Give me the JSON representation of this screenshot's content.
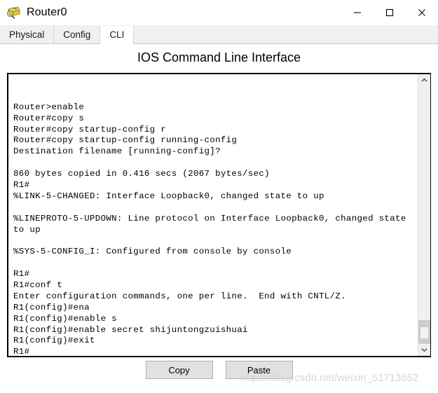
{
  "window": {
    "title": "Router0",
    "icon": "packet-tracer-router-icon",
    "controls": {
      "minimize": "—",
      "maximize": "□",
      "close": "✕"
    }
  },
  "tabs": [
    {
      "label": "Physical",
      "active": false
    },
    {
      "label": "Config",
      "active": false
    },
    {
      "label": "CLI",
      "active": true
    }
  ],
  "panel": {
    "title": "IOS Command Line Interface"
  },
  "terminal": {
    "lines": [
      "",
      "",
      "Router>enable",
      "Router#copy s",
      "Router#copy startup-config r",
      "Router#copy startup-config running-config",
      "Destination filename [running-config]?",
      "",
      "860 bytes copied in 0.416 secs (2067 bytes/sec)",
      "R1#",
      "%LINK-5-CHANGED: Interface Loopback0, changed state to up",
      "",
      "%LINEPROTO-5-UPDOWN: Line protocol on Interface Loopback0, changed state",
      "to up",
      "",
      "%SYS-5-CONFIG_I: Configured from console by console",
      "",
      "R1#",
      "R1#conf t",
      "Enter configuration commands, one per line.  End with CNTL/Z.",
      "R1(config)#ena",
      "R1(config)#enable s",
      "R1(config)#enable secret shijuntongzuishuai",
      "R1(config)#exit",
      "R1#"
    ]
  },
  "scrollbar": {
    "up_arrow": "ⱏ",
    "down_arrow": "ⱟ"
  },
  "buttons": {
    "copy": "Copy",
    "paste": "Paste"
  },
  "watermark": {
    "text": "https://blog.csdn.net/weixin_51713652"
  },
  "colors": {
    "tab_active_bg": "#ffffff",
    "tab_inactive_bg": "#f0f0f0",
    "button_bg": "#e1e1e1",
    "terminal_border": "#000000",
    "scrollbar_thumb": "#cdcdcd",
    "watermark": "#d6d6d6"
  }
}
